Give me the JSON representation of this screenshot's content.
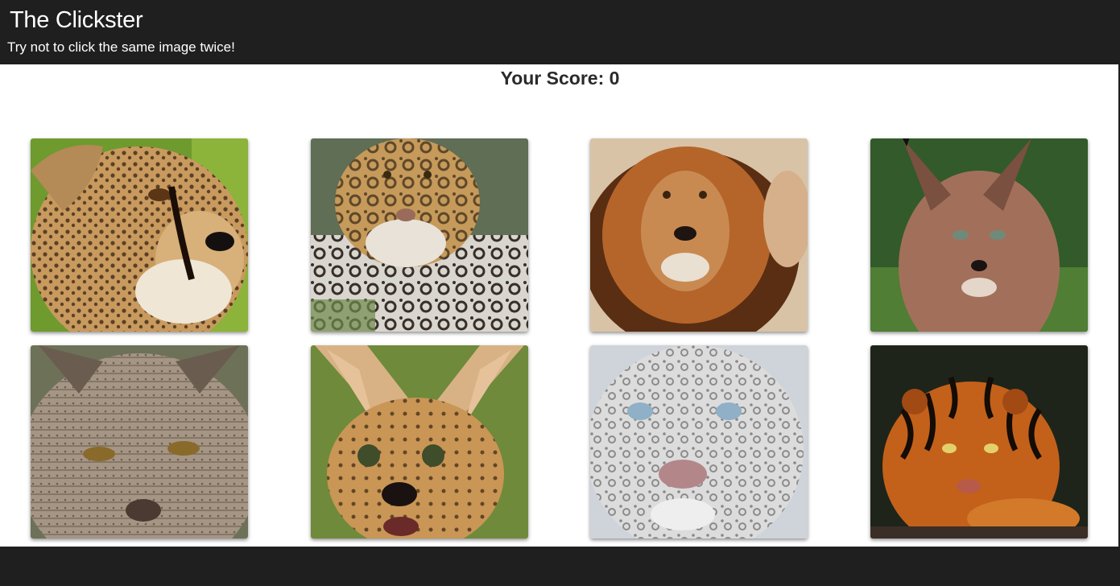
{
  "header": {
    "title": "The Clickster",
    "subtitle": "Try not to click the same image twice!"
  },
  "score": {
    "text": "Your Score: 0"
  },
  "colors": {
    "bar": "#1f1f1f",
    "page": "#ffffff"
  },
  "cards": [
    {
      "name": "cheetah-image",
      "icon": "cheetah-icon"
    },
    {
      "name": "jaguar-image",
      "icon": "jaguar-icon"
    },
    {
      "name": "lion-image",
      "icon": "lion-icon"
    },
    {
      "name": "caracal-image",
      "icon": "caracal-icon"
    },
    {
      "name": "lynx-image",
      "icon": "lynx-icon"
    },
    {
      "name": "serval-image",
      "icon": "serval-icon"
    },
    {
      "name": "snow-leopard-image",
      "icon": "snow-leopard-icon"
    },
    {
      "name": "tiger-image",
      "icon": "tiger-icon"
    }
  ]
}
